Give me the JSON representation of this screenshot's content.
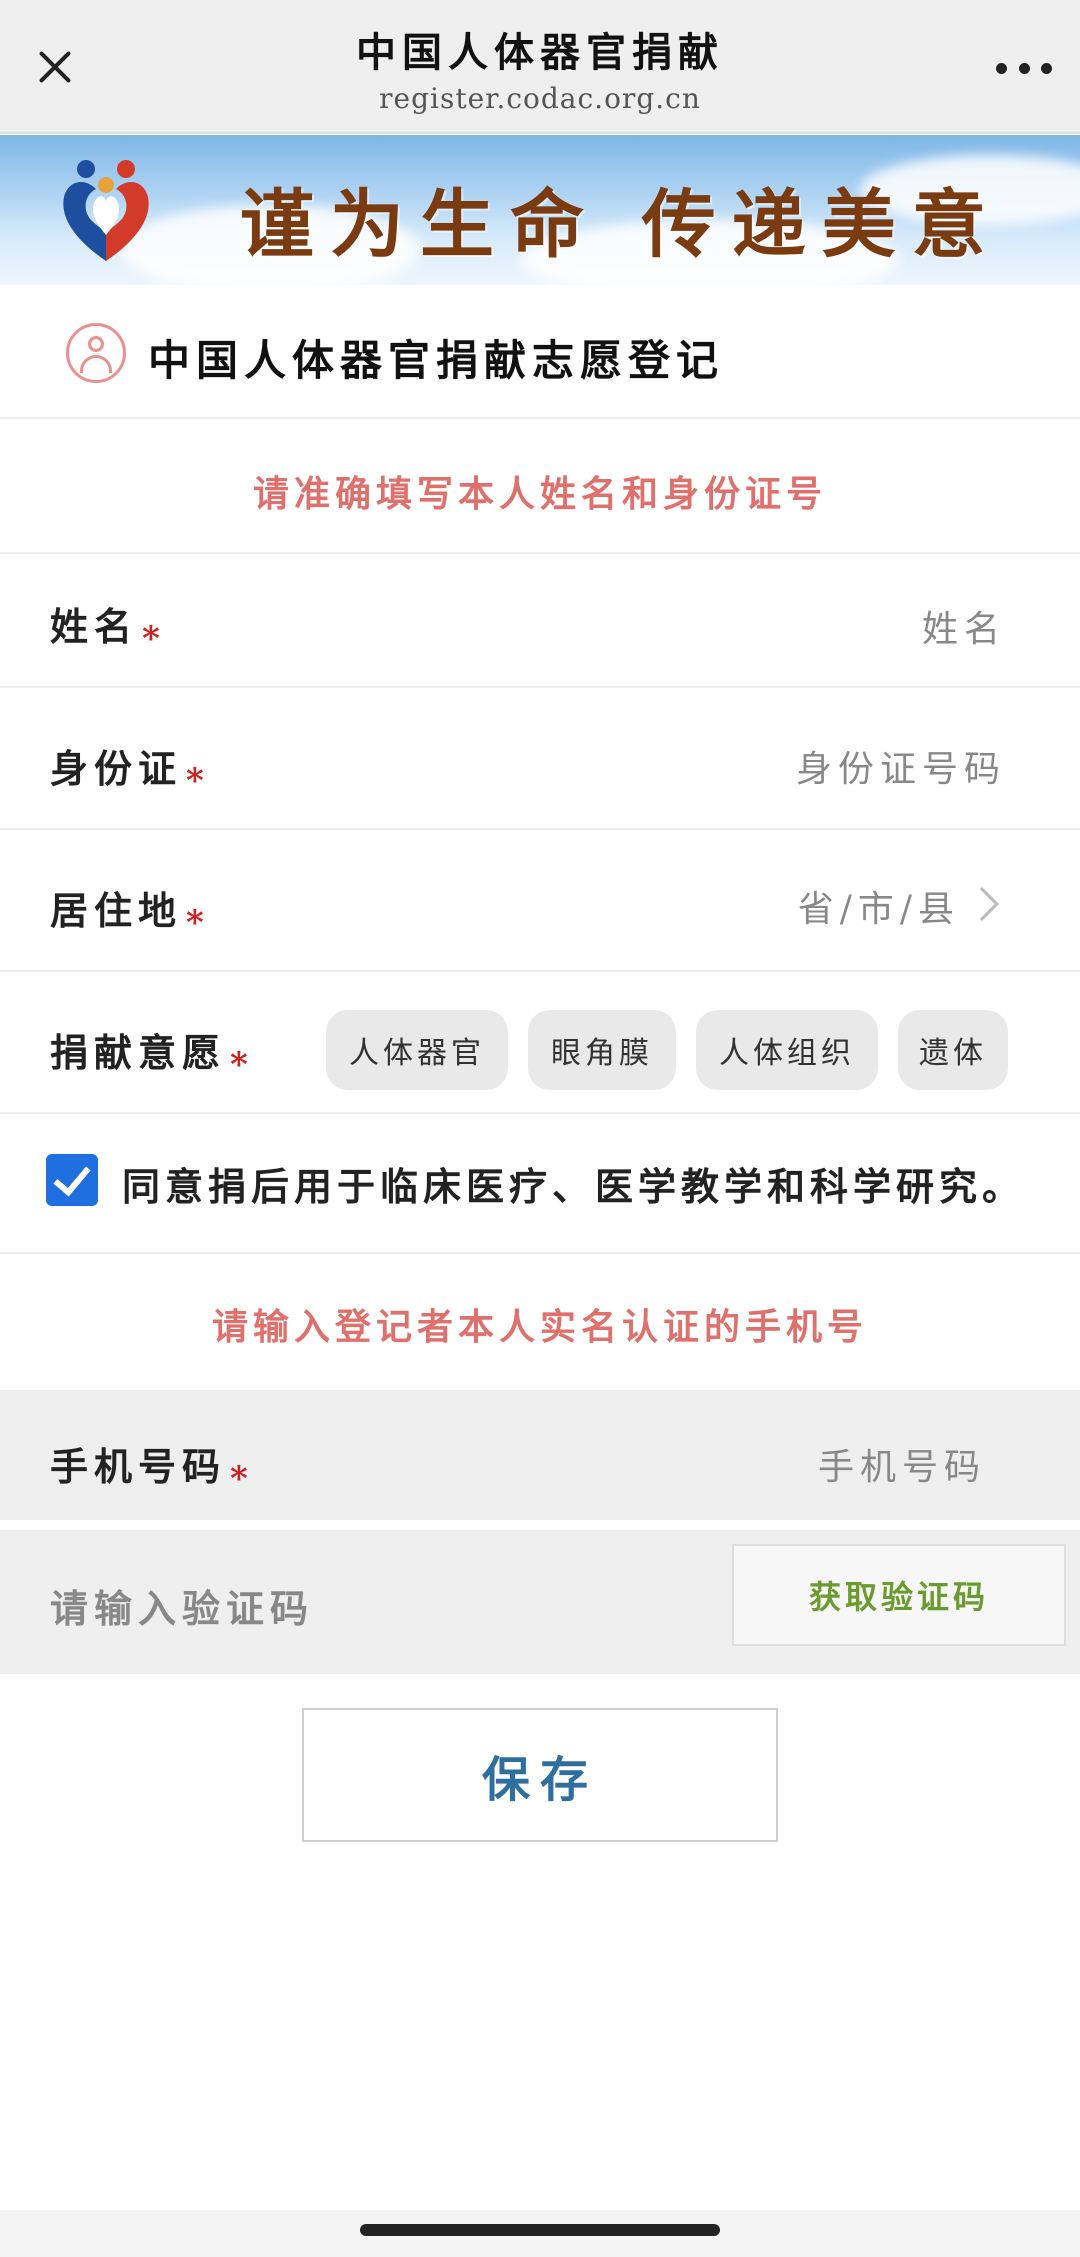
{
  "nav": {
    "title": "中国人体器官捐献",
    "url": "register.codac.org.cn"
  },
  "banner": {
    "slogan": "谨为生命 传递美意"
  },
  "section": {
    "title": "中国人体器官捐献志愿登记"
  },
  "hints": {
    "identity": "请准确填写本人姓名和身份证号",
    "phone": "请输入登记者本人实名认证的手机号"
  },
  "form": {
    "name": {
      "label": "姓名",
      "required": "*",
      "placeholder": "姓名"
    },
    "id_card": {
      "label": "身份证",
      "required": "*",
      "placeholder": "身份证号码"
    },
    "residence": {
      "label": "居住地",
      "required": "*",
      "placeholder": "省/市/县"
    },
    "donation": {
      "label": "捐献意愿",
      "required": "*",
      "options": [
        "人体器官",
        "眼角膜",
        "人体组织",
        "遗体"
      ]
    },
    "agree": {
      "checked": true,
      "text": "同意捐后用于临床医疗、医学教学和科学研究。"
    },
    "phone": {
      "label": "手机号码",
      "required": "*",
      "placeholder": "手机号码"
    },
    "code": {
      "placeholder": "请输入验证码",
      "button": "获取验证码"
    },
    "save": "保存"
  },
  "colors": {
    "hint": "#e0706c",
    "required": "#d02020",
    "checkbox": "#1f6fe0",
    "code_button": "#6a9b2e",
    "save_text": "#2f6f9f"
  }
}
